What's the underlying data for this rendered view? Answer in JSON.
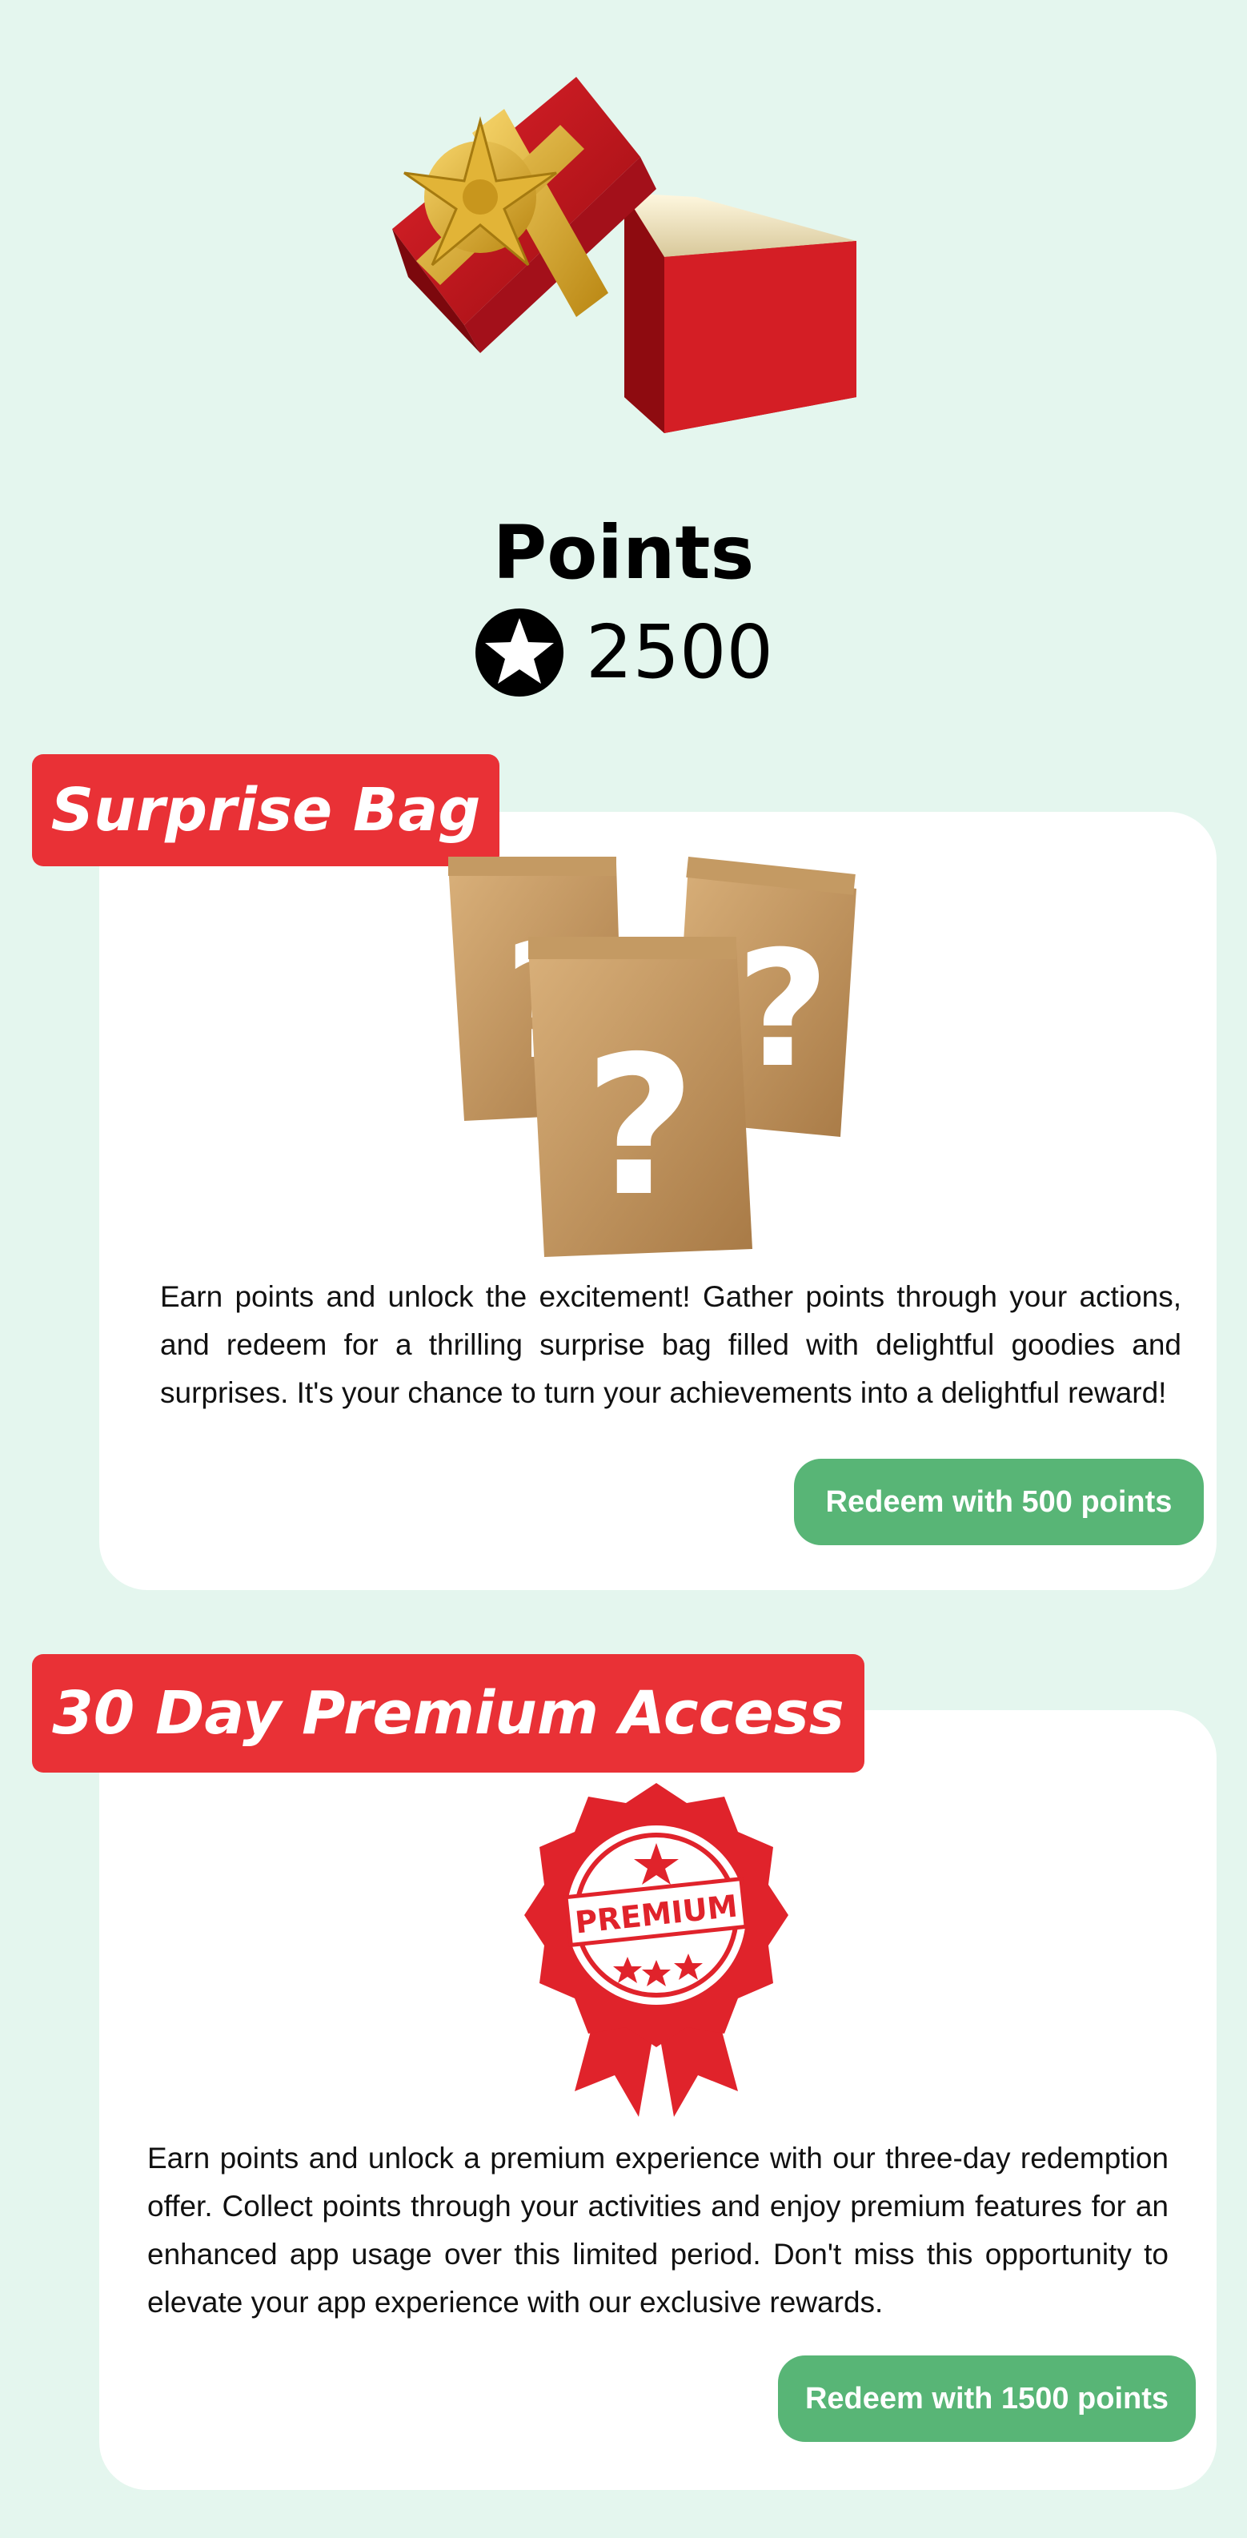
{
  "header": {
    "title": "Points",
    "points_value": "2500",
    "icons": {
      "gift": "gift-box-icon",
      "star": "star-icon"
    }
  },
  "rewards": [
    {
      "title": "Surprise Bag",
      "image": "surprise-bags-icon",
      "description": "Earn points and unlock the excitement! Gather points through your actions, and redeem for a thrilling surprise bag filled with delightful goodies and surprises. It's your chance to turn your achievements into a delightful reward!",
      "button_label": "Redeem with 500 points"
    },
    {
      "title": "30 Day Premium Access",
      "image": "premium-seal-icon",
      "image_text": "PREMIUM",
      "description": "Earn points and unlock a premium experience with our three-day redemption offer. Collect points through your activities and enjoy premium features for an enhanced app usage over this limited period. Don't miss this opportunity to elevate your app experience with our exclusive rewards.",
      "button_label": "Redeem with 1500 points"
    }
  ],
  "colors": {
    "background": "#e4f6ee",
    "card": "#ffffff",
    "tag": "#e93136",
    "button": "#58b576",
    "text": "#111111"
  }
}
